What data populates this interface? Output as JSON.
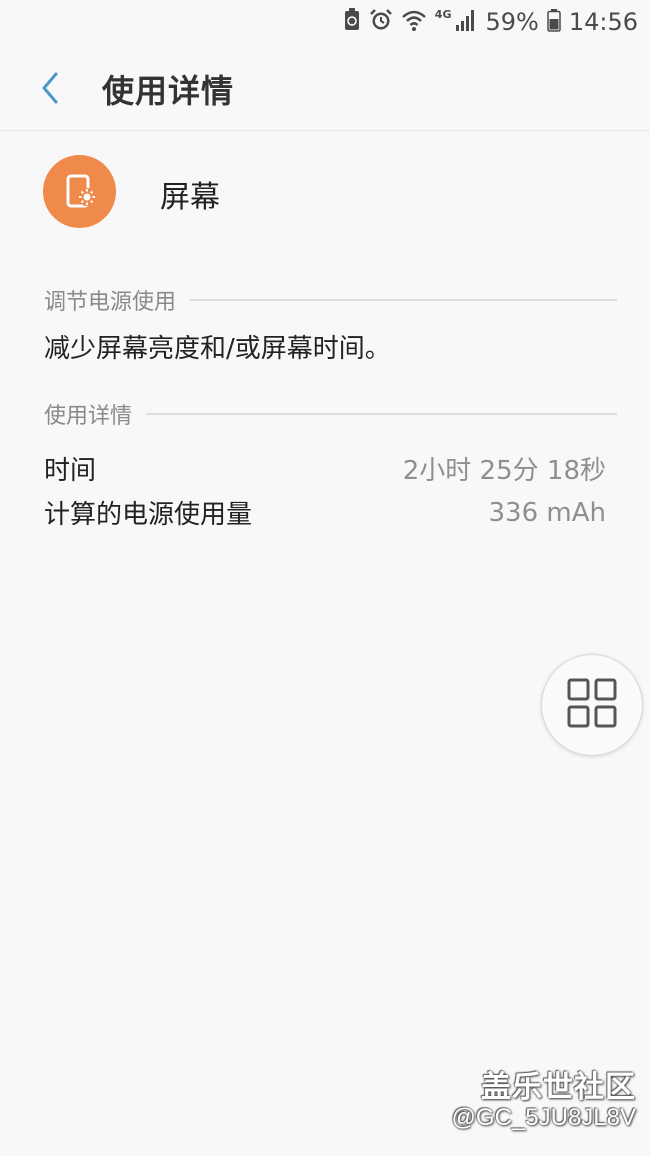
{
  "status_bar": {
    "network_type": "4G",
    "battery_percent": "59%",
    "time": "14:56",
    "icons": [
      "battery-saver-icon",
      "alarm-icon",
      "wifi-icon",
      "signal-icon",
      "battery-icon"
    ]
  },
  "header": {
    "title": "使用详情",
    "back_icon": "chevron-left-icon"
  },
  "app": {
    "name": "屏幕",
    "icon": "screen-brightness-icon",
    "icon_color": "#f08a4b"
  },
  "adjust_section": {
    "label": "调节电源使用",
    "tip": "减少屏幕亮度和/或屏幕时间。"
  },
  "details_section": {
    "label": "使用详情",
    "rows": [
      {
        "label": "时间",
        "value": "2小时 25分 18秒"
      },
      {
        "label": "计算的电源使用量",
        "value": "336 mAh"
      }
    ]
  },
  "floating_button": {
    "icon": "multi-window-grid-icon"
  },
  "watermark": {
    "brand": "盖乐世社区",
    "user": "@GC_5JU8JL8V"
  }
}
